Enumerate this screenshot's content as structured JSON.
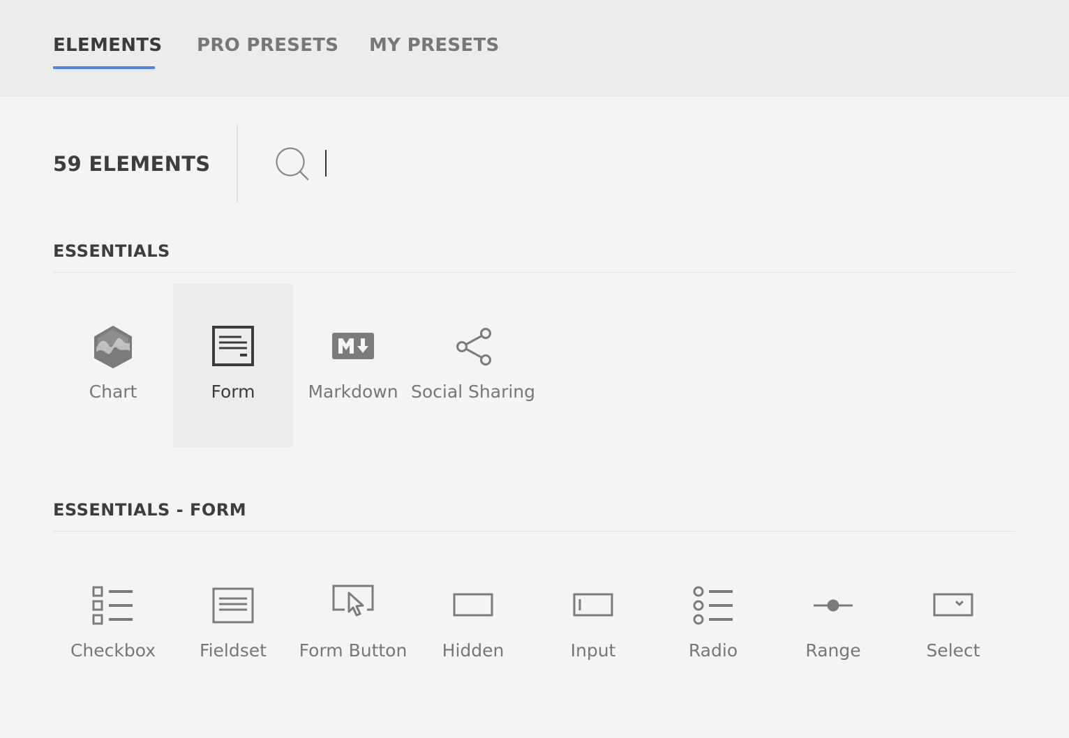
{
  "tabs": {
    "elements": "ELEMENTS",
    "pro_presets": "PRO PRESETS",
    "my_presets": "MY PRESETS",
    "active": "ELEMENTS",
    "accent_color": "#4a86e8"
  },
  "toolbar": {
    "count_label": "59 ELEMENTS",
    "search_value": "",
    "search_icon": "search-icon"
  },
  "sections": {
    "essentials": {
      "title": "ESSENTIALS",
      "items": [
        {
          "label": "Chart",
          "icon": "chart-icon"
        },
        {
          "label": "Form",
          "icon": "form-icon",
          "selected": true
        },
        {
          "label": "Markdown",
          "icon": "markdown-icon"
        },
        {
          "label": "Social Sharing",
          "icon": "share-icon"
        }
      ]
    },
    "essentials_form": {
      "title": "ESSENTIALS - FORM",
      "items": [
        {
          "label": "Checkbox",
          "icon": "checkbox-list-icon"
        },
        {
          "label": "Fieldset",
          "icon": "fieldset-icon"
        },
        {
          "label": "Form Button",
          "icon": "form-button-icon"
        },
        {
          "label": "Hidden",
          "icon": "hidden-field-icon"
        },
        {
          "label": "Input",
          "icon": "input-field-icon"
        },
        {
          "label": "Radio",
          "icon": "radio-list-icon"
        },
        {
          "label": "Range",
          "icon": "range-slider-icon"
        },
        {
          "label": "Select",
          "icon": "select-dropdown-icon"
        }
      ]
    }
  }
}
